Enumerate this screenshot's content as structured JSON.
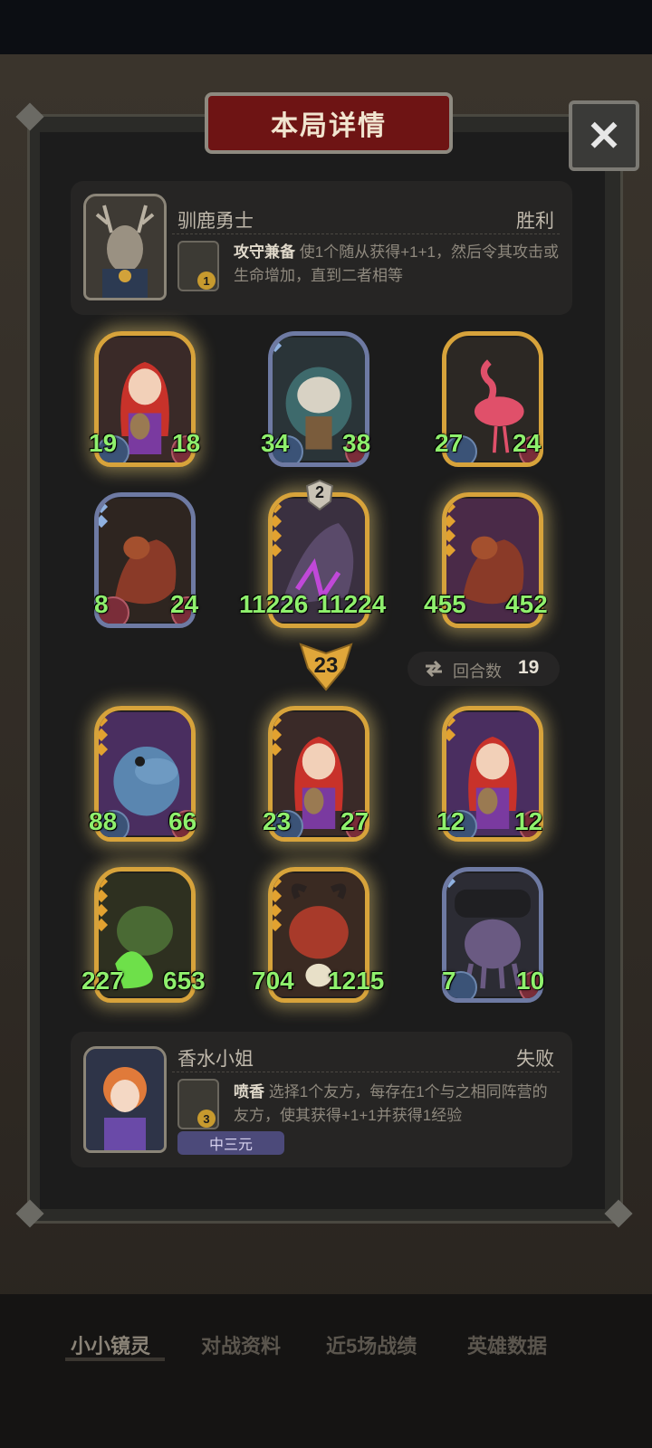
{
  "dialog": {
    "title": "本局详情",
    "close_symbol": "✕"
  },
  "player_top": {
    "name": "驯鹿勇士",
    "result": "胜利",
    "skill": {
      "name": "攻守兼备",
      "badge": "1",
      "desc": "使1个随从获得+1+1，然后令其攻击或生命增加，直到二者相等"
    }
  },
  "player_bottom": {
    "name": "香水小姐",
    "result": "失败",
    "tag": "中三元",
    "skill": {
      "name": "喷香",
      "badge": "3",
      "desc": "选择1个友方，每存在1个与之相同阵营的友方，使其获得+1+1并获得1经验"
    }
  },
  "top_cards": [
    {
      "atk": "19",
      "hp": "18"
    },
    {
      "atk": "34",
      "hp": "38"
    },
    {
      "atk": "27",
      "hp": "24"
    },
    {
      "atk": "8",
      "hp": "24"
    },
    {
      "atk": "11226",
      "hp": "11224"
    },
    {
      "atk": "455",
      "hp": "452"
    }
  ],
  "level_badge": "2",
  "round": {
    "current": "23",
    "label": "回合数",
    "count": "19"
  },
  "bottom_cards": [
    {
      "atk": "88",
      "hp": "66"
    },
    {
      "atk": "23",
      "hp": "27"
    },
    {
      "atk": "12",
      "hp": "12"
    },
    {
      "atk": "227",
      "hp": "653"
    },
    {
      "atk": "704",
      "hp": "1215"
    },
    {
      "atk": "7",
      "hp": "10"
    }
  ],
  "bottom_nav": [
    "小小镜灵",
    "对战资料",
    "近5场战绩",
    "英雄数据"
  ],
  "colors": {
    "stat_green": "#8ff06d",
    "gold_frame": "#d7a33b",
    "title_red": "#6e1414"
  },
  "icons": {
    "close": "close-icon",
    "round": "swap-arrows-icon"
  }
}
